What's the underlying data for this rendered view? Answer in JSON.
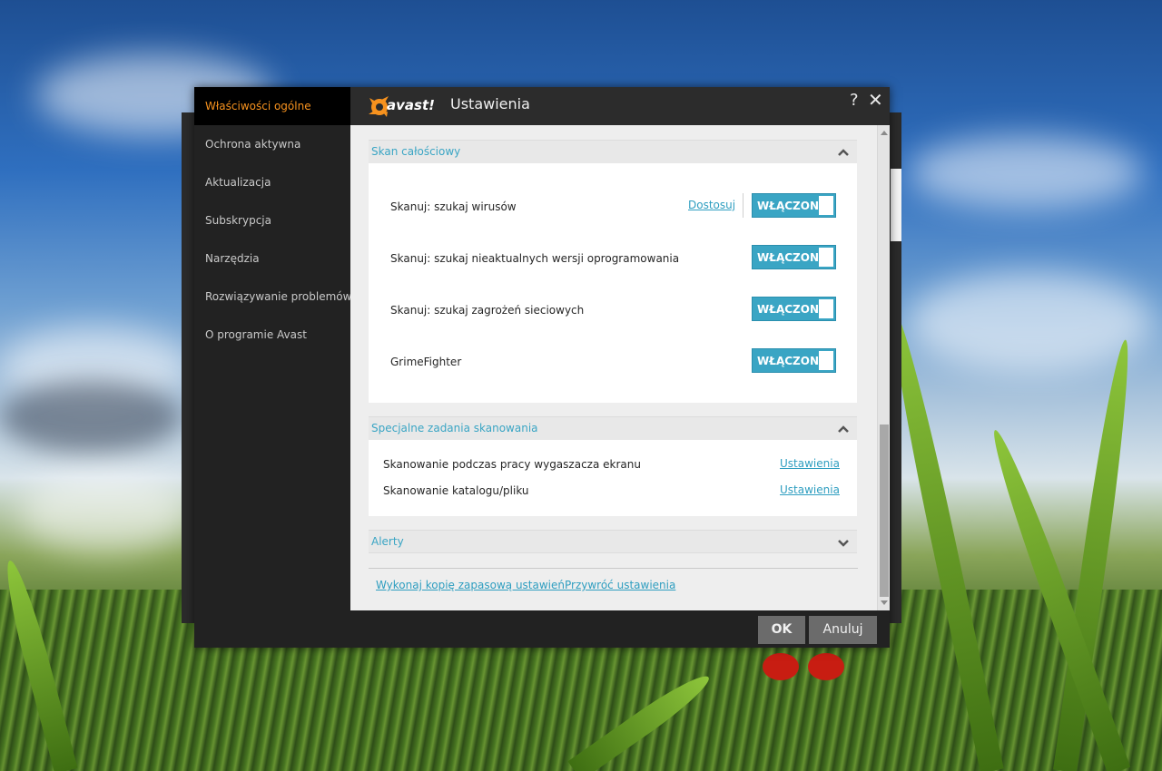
{
  "app": {
    "brand": "avast!",
    "title": "Ustawienia",
    "help_symbol": "?",
    "close_symbol": "✕"
  },
  "sidebar": {
    "items": [
      {
        "label": "Właściwości ogólne",
        "active": true
      },
      {
        "label": "Ochrona aktywna"
      },
      {
        "label": "Aktualizacja"
      },
      {
        "label": "Subskrypcja"
      },
      {
        "label": "Narzędzia"
      },
      {
        "label": "Rozwiązywanie problemów"
      },
      {
        "label": "O programie Avast"
      }
    ]
  },
  "sections": {
    "full_scan": {
      "title": "Skan całościowy",
      "expanded": true,
      "rows": [
        {
          "label": "Skanuj: szukaj wirusów",
          "link": "Dostosuj",
          "toggle": "WŁĄCZONE"
        },
        {
          "label": "Skanuj: szukaj nieaktualnych wersji oprogramowania",
          "toggle": "WŁĄCZONE"
        },
        {
          "label": "Skanuj: szukaj zagrożeń sieciowych",
          "toggle": "WŁĄCZONE"
        },
        {
          "label": "GrimeFighter",
          "toggle": "WŁĄCZONE"
        }
      ]
    },
    "special_tasks": {
      "title": "Specjalne zadania skanowania",
      "expanded": true,
      "rows": [
        {
          "label": "Skanowanie podczas pracy wygaszacza ekranu",
          "link": "Ustawienia"
        },
        {
          "label": "Skanowanie katalogu/pliku",
          "link": "Ustawienia"
        }
      ]
    },
    "alerts": {
      "title": "Alerty",
      "expanded": false
    }
  },
  "bottom_links": {
    "backup": "Wykonaj kopię zapasową ustawień",
    "restore": "Przywróć ustawienia"
  },
  "buttons": {
    "ok": "OK",
    "cancel": "Anuluj"
  },
  "colors": {
    "accent": "#3aa5c4",
    "active_nav": "#f7921e",
    "dark_bg": "#222222"
  }
}
